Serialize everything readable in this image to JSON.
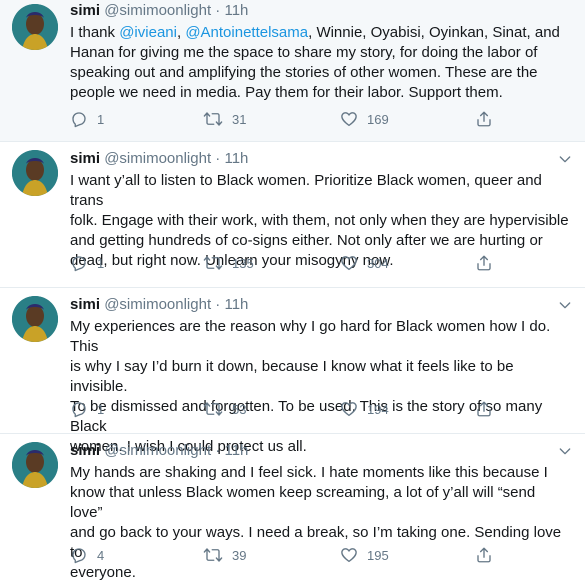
{
  "user": {
    "name": "simi",
    "handle": "@simimoonlight",
    "dot": "·",
    "time": "11h"
  },
  "tweets": [
    {
      "segments": [
        "I thank ",
        "@ivieani",
        ", ",
        "@Antoinettelsama",
        ", Winnie, Oyabisi, Oyinkan, Sinat, and\nHanan for giving me the space to share my story, for doing the labor of\nspeaking out and amplifying the stories of other women. These are the\npeople we need in media. Pay them for their labor. Support them."
      ],
      "replies": "1",
      "retweets": "31",
      "likes": "169"
    },
    {
      "text": "I want y’all to listen to Black women. Prioritize Black women, queer and trans\nfolk. Engage with their work, with them, not only when they are hypervisible\nand getting hundreds of co-signs either. Not only after we are hurting or\ndead, but right now. Unlearn your misogyny now.",
      "replies": "1",
      "retweets": "135",
      "likes": "304"
    },
    {
      "text": "My experiences are the reason why I go hard for Black women how I do. This\nis why I say I’d burn it down, because I know what it feels like to be invisible.\nTo be dismissed and forgotten. To be used. This is the story of so many Black\nwomen. I wish I could protect us all.",
      "replies": "1",
      "retweets": "53",
      "likes": "194"
    },
    {
      "text": "My hands are shaking and I feel sick. I hate moments like this because I\nknow that unless Black women keep screaming, a lot of y’all will “send love”\nand go back to your ways. I need a break, so I’m taking one. Sending love to\neveryone.",
      "replies": "4",
      "retweets": "39",
      "likes": "195"
    }
  ],
  "icons": {
    "reply": "reply-icon",
    "retweet": "retweet-icon",
    "like": "heart-icon",
    "share": "share-icon",
    "more": "chevron-down-icon"
  },
  "colors": {
    "text": "#14171a",
    "secondary": "#657786",
    "link": "#1b95e0",
    "highlight_bg": "#f5f8fa",
    "divider": "#e6ecf0"
  }
}
